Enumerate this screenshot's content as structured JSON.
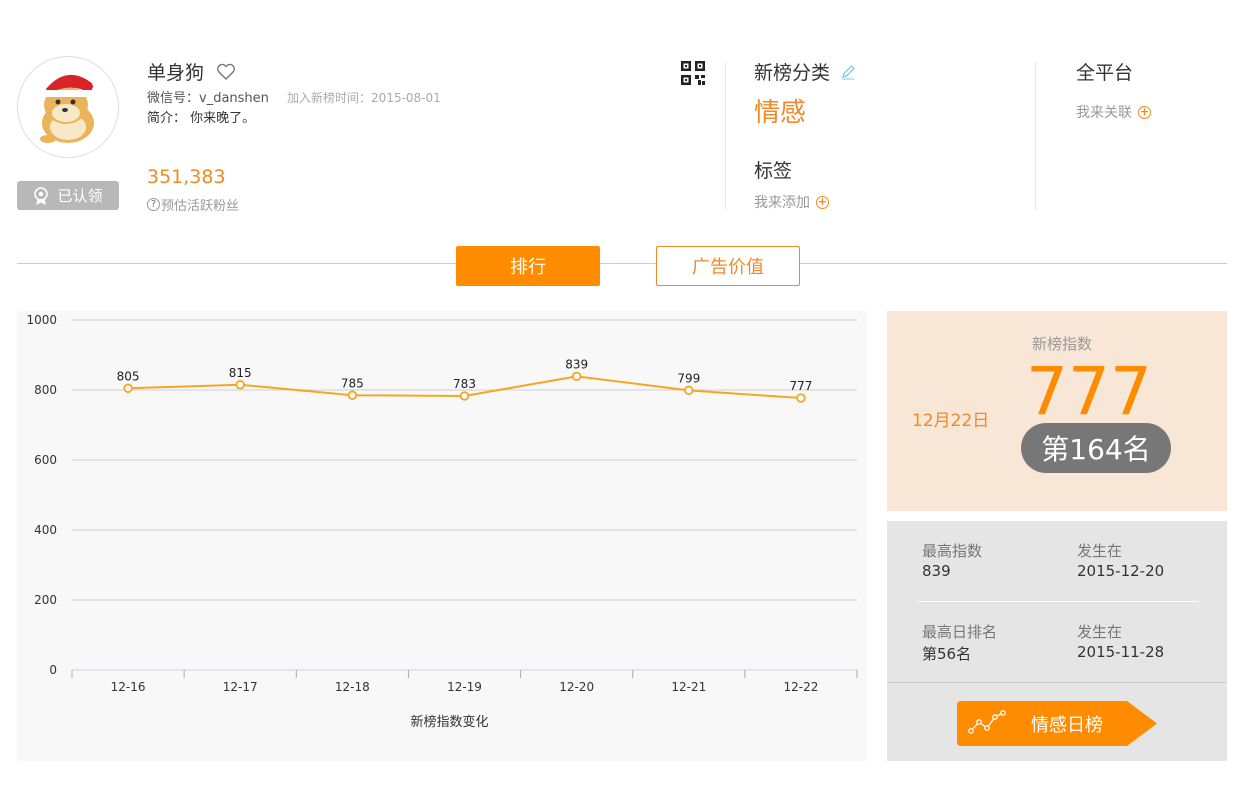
{
  "profile": {
    "name": "单身狗",
    "wechat_id": "微信号：v_danshen",
    "join_time": "加入新榜时间：2015-08-01",
    "intro": "简介：  你来晚了。",
    "verified_label": "已认领",
    "fans_count": "351,383",
    "fans_label": "预估活跃粉丝"
  },
  "category": {
    "title": "新榜分类",
    "value": "情感",
    "tag_title": "标签",
    "tag_add": "我来添加"
  },
  "platform": {
    "title": "全平台",
    "link_label": "我来关联"
  },
  "tabs": [
    {
      "label": "排行",
      "active": true
    },
    {
      "label": "广告价值",
      "active": false
    }
  ],
  "index_panel": {
    "label": "新榜指数",
    "date": "12月22日",
    "value": "777",
    "rank": "第164名"
  },
  "stats": {
    "max_index_label": "最高指数",
    "max_index_value": "839",
    "max_index_date_label": "发生在",
    "max_index_date": "2015-12-20",
    "max_rank_label": "最高日排名",
    "max_rank_value": "第56名",
    "max_rank_date_label": "发生在",
    "max_rank_date": "2015-11-28"
  },
  "daily_button": {
    "label": "情感日榜"
  },
  "colors": {
    "accent": "#ff8c00",
    "line": "#f5a623",
    "rank_pill": "#777777"
  },
  "chart_data": {
    "type": "line",
    "categories": [
      "12-16",
      "12-17",
      "12-18",
      "12-19",
      "12-20",
      "12-21",
      "12-22"
    ],
    "series": [
      {
        "values": [
          805,
          815,
          785,
          783,
          839,
          799,
          777
        ]
      }
    ],
    "title": "",
    "xlabel": "新榜指数变化",
    "ylabel": "",
    "ylim": [
      0,
      1000
    ],
    "yticks": [
      0,
      200,
      400,
      600,
      800,
      1000
    ],
    "grid": true,
    "legend": "none"
  }
}
